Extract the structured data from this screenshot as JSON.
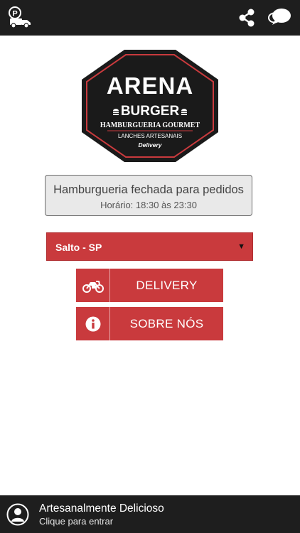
{
  "topbar": {
    "left_icon": "parking-truck-icon",
    "share_icon": "share-icon",
    "chat_icon": "chat-bubbles-icon"
  },
  "logo": {
    "line1": "ARENA",
    "line2": "BURGER",
    "line3": "HAMBURGUERIA GOURMET",
    "line4": "LANCHES ARTESANAIS",
    "line5": "Delivery"
  },
  "status": {
    "title": "Hamburgueria fechada para pedidos",
    "hours": "Horário: 18:30 às 23:30"
  },
  "city_select": {
    "value": "Salto - SP",
    "caret": "▼"
  },
  "buttons": {
    "delivery": {
      "label": "DELIVERY",
      "icon": "motorcycle-icon"
    },
    "about": {
      "label": "SOBRE NÓS",
      "icon": "info-icon"
    }
  },
  "bottombar": {
    "title": "Artesanalmente Delicioso",
    "subtitle": "Clique para entrar",
    "icon": "user-avatar-icon"
  },
  "colors": {
    "topbar": "#1e1e1e",
    "accent_red": "#c93a3d",
    "status_bg": "#e9e9e9"
  }
}
